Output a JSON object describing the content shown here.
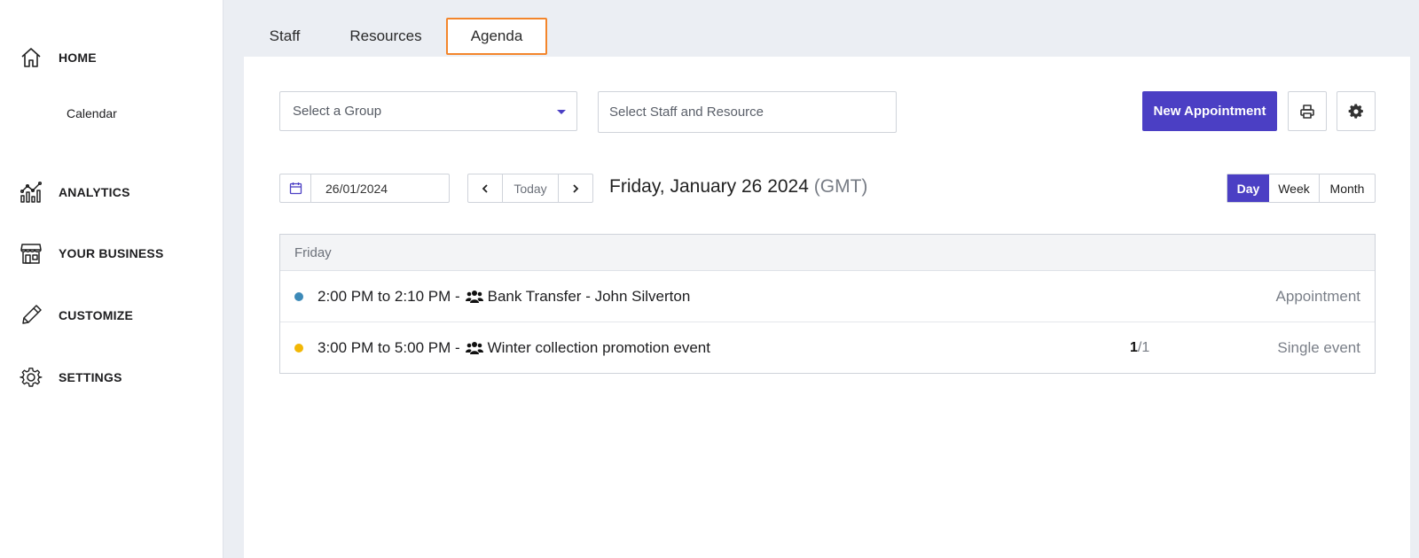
{
  "sidebar": {
    "home": "HOME",
    "calendar": "Calendar",
    "analytics": "ANALYTICS",
    "your_business": "YOUR BUSINESS",
    "customize": "CUSTOMIZE",
    "settings": "SETTINGS"
  },
  "tabs": [
    "Staff",
    "Resources",
    "Agenda"
  ],
  "toolbar": {
    "group_select": "Select a Group",
    "staff_placeholder": "Select Staff and Resource",
    "new_appointment": "New Appointment"
  },
  "date_nav": {
    "date_value": "26/01/2024",
    "today": "Today",
    "title": "Friday, January 26 2024",
    "timezone": "(GMT)"
  },
  "views": [
    "Day",
    "Week",
    "Month"
  ],
  "agenda": {
    "day_header": "Friday",
    "rows": [
      {
        "time": "2:00 PM to 2:10 PM -",
        "title": "Bank Transfer - John Silverton",
        "capacity_booked": "",
        "capacity_total": "",
        "type": "Appointment",
        "dot_color": "#3d8ab8"
      },
      {
        "time": "3:00 PM to 5:00 PM -",
        "title": "Winter collection promotion event",
        "capacity_booked": "1",
        "capacity_total": "/1",
        "type": "Single event",
        "dot_color": "#f2b705"
      }
    ]
  },
  "colors": {
    "accent": "#4b3fc4",
    "active_tab_border": "#f3852b"
  }
}
